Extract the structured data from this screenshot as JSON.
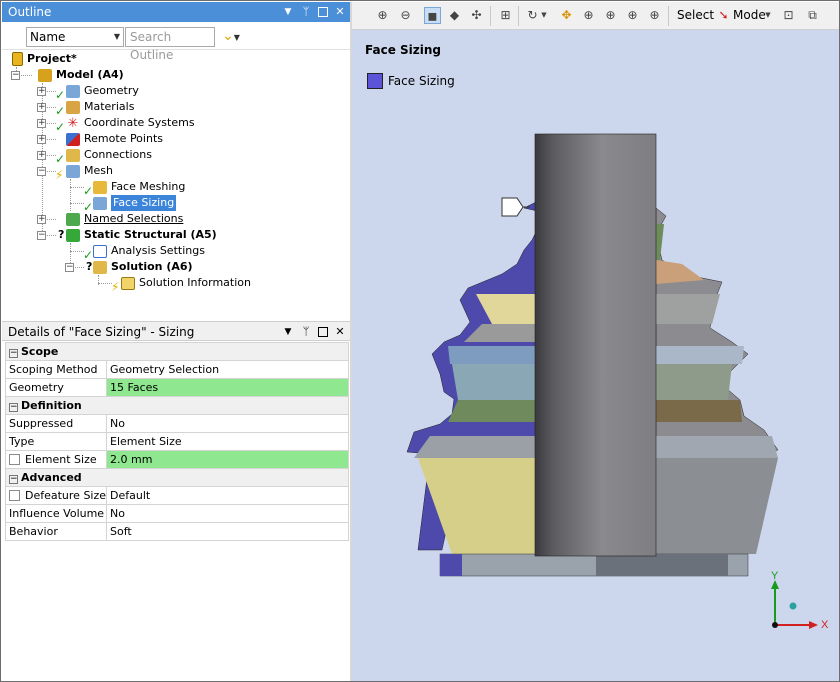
{
  "outline": {
    "title": "Outline",
    "name_select": "Name",
    "search_placeholder": "Search Outline",
    "tree": [
      {
        "id": "project",
        "label": "Project*"
      },
      {
        "id": "model",
        "label": "Model (A4)"
      },
      {
        "id": "geometry",
        "label": "Geometry"
      },
      {
        "id": "materials",
        "label": "Materials"
      },
      {
        "id": "coordinate-systems",
        "label": "Coordinate Systems"
      },
      {
        "id": "remote-points",
        "label": "Remote Points"
      },
      {
        "id": "connections",
        "label": "Connections"
      },
      {
        "id": "mesh",
        "label": "Mesh"
      },
      {
        "id": "face-meshing",
        "label": "Face Meshing"
      },
      {
        "id": "face-sizing",
        "label": "Face Sizing"
      },
      {
        "id": "named-selections",
        "label": "Named Selections"
      },
      {
        "id": "static-structural",
        "label": "Static Structural (A5)"
      },
      {
        "id": "analysis-settings",
        "label": "Analysis Settings"
      },
      {
        "id": "solution",
        "label": "Solution (A6)"
      },
      {
        "id": "solution-information",
        "label": "Solution Information"
      }
    ]
  },
  "details": {
    "title": "Details of \"Face Sizing\" - Sizing",
    "sections": {
      "scope": "Scope",
      "definition": "Definition",
      "advanced": "Advanced"
    },
    "rows": {
      "scoping_method": {
        "key": "Scoping Method",
        "value": "Geometry Selection"
      },
      "geometry": {
        "key": "Geometry",
        "value": "15 Faces"
      },
      "suppressed": {
        "key": "Suppressed",
        "value": "No"
      },
      "type": {
        "key": "Type",
        "value": "Element Size"
      },
      "element_size": {
        "key": "Element Size",
        "value": "2.0 mm"
      },
      "defeature_size": {
        "key": "Defeature Size",
        "value": "Default"
      },
      "influence_volume": {
        "key": "Influence Volume",
        "value": "No"
      },
      "behavior": {
        "key": "Behavior",
        "value": "Soft"
      }
    }
  },
  "graphics": {
    "toolbar": {
      "select_label": "Select",
      "mode_label": "Mode"
    },
    "view_title": "Face Sizing",
    "legend_label": "Face Sizing",
    "legend_color": "#5b53d8",
    "triad": {
      "y": "Y",
      "x": "X"
    }
  }
}
